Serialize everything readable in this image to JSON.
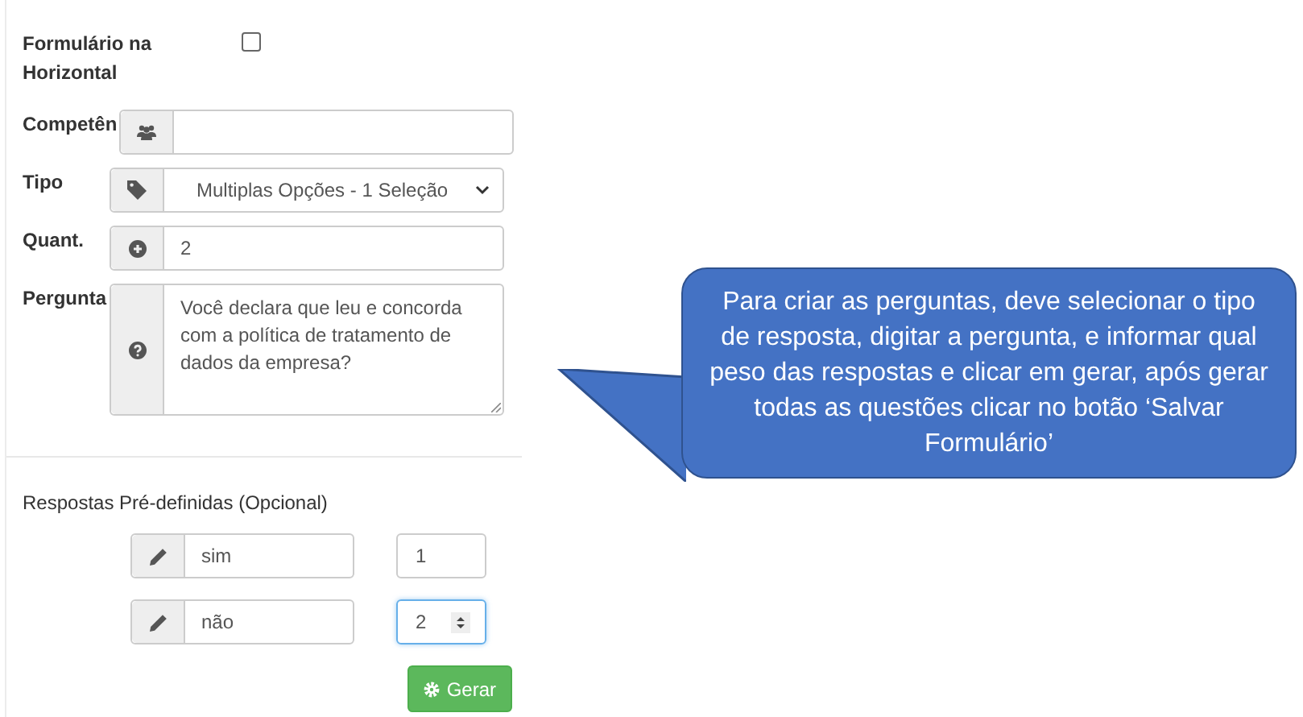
{
  "form": {
    "fields": [
      {
        "kind": "checkbox",
        "label": "Formulário na Horizontal",
        "checked": false
      },
      {
        "kind": "input",
        "label": "Competên"
      },
      {
        "kind": "select",
        "label": "Tipo",
        "value": "Multiplas Opções - 1 Seleção"
      },
      {
        "kind": "input",
        "label": "Quant.",
        "value": "2"
      },
      {
        "kind": "textarea",
        "label": "Pergunta",
        "value": "Você declara que leu e concorda com a política de tratamento de dados da empresa?"
      }
    ]
  },
  "answers": {
    "title": "Respostas Pré-definidas (Opcional)",
    "rows": [
      {
        "text": "sim",
        "weight": "1",
        "focused": false
      },
      {
        "text": "não",
        "weight": "2",
        "focused": true
      }
    ]
  },
  "button": {
    "label": "Gerar"
  },
  "callout": {
    "text": "Para criar as perguntas, deve selecionar o tipo de resposta, digitar a pergunta, e informar qual peso das respostas e clicar em gerar, após gerar todas as questões clicar no botão ‘Salvar Formulário’"
  }
}
